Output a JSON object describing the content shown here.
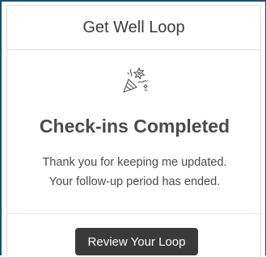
{
  "card": {
    "title": "Get Well Loop",
    "icon": "party-popper-icon",
    "status_heading": "Check-ins Completed",
    "message_line1": "Thank you for keeping me updated.",
    "message_line2": "Your follow-up period has ended.",
    "review_button_label": "Review Your Loop"
  },
  "colors": {
    "frame_border": "#1f4f6f",
    "text": "#4a4a4a",
    "button_bg": "#3a3a3a",
    "button_text": "#ffffff"
  }
}
